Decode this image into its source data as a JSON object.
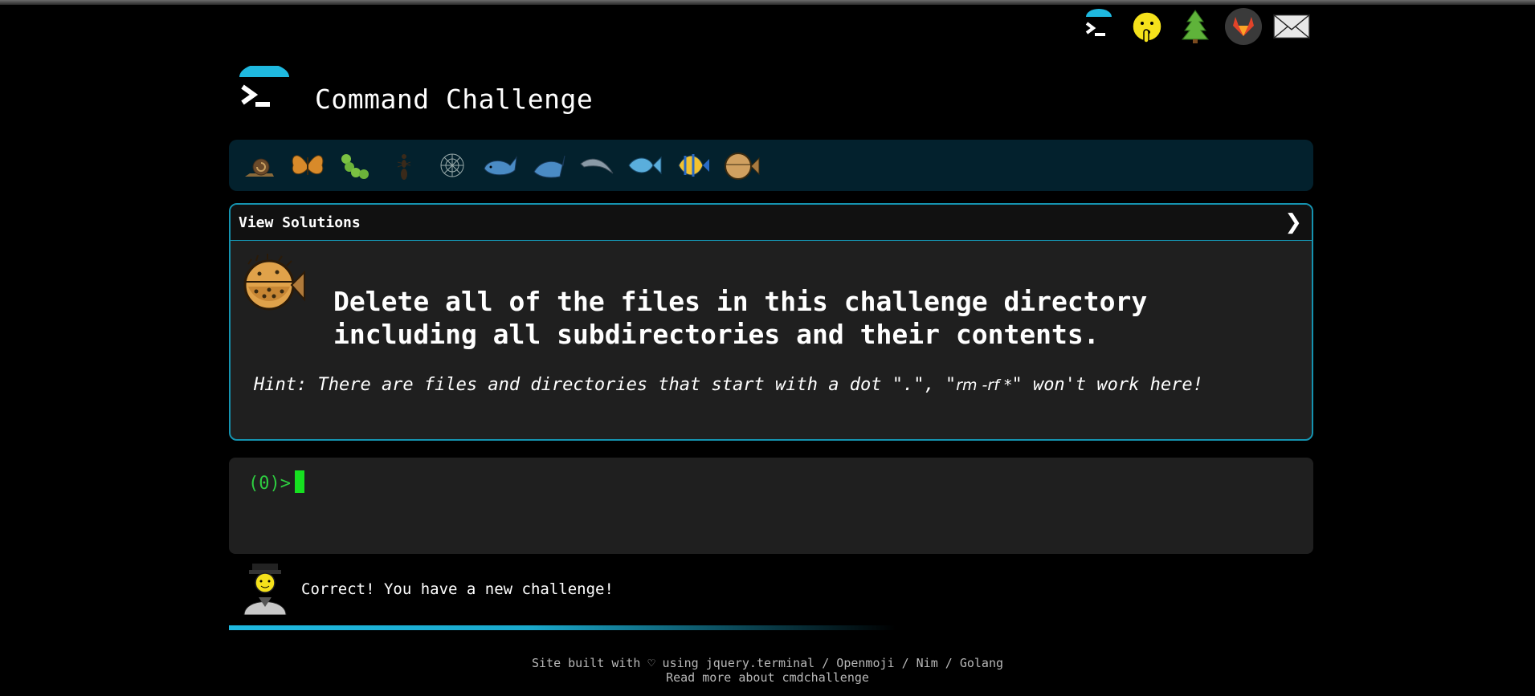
{
  "header": {
    "title": "Command Challenge"
  },
  "top_icons": [
    {
      "icon": "terminal-logo-icon"
    },
    {
      "icon": "shushing-face-icon"
    },
    {
      "icon": "evergreen-tree-icon"
    },
    {
      "icon": "gitlab-icon"
    },
    {
      "icon": "envelope-icon"
    }
  ],
  "levels": [
    {
      "icon": "snail-icon"
    },
    {
      "icon": "butterfly-icon"
    },
    {
      "icon": "caterpillar-icon"
    },
    {
      "icon": "ant-icon"
    },
    {
      "icon": "spider-web-icon"
    },
    {
      "icon": "whale-icon"
    },
    {
      "icon": "shark-icon"
    },
    {
      "icon": "dolphin-icon"
    },
    {
      "icon": "fish-icon"
    },
    {
      "icon": "tropical-fish-icon"
    },
    {
      "icon": "blowfish-icon"
    }
  ],
  "challenge": {
    "view_solutions": "View Solutions",
    "chevron": "❯",
    "task": "Delete all of the files in this challenge directory including all subdirectories and their contents.",
    "hint_prefix": "Hint: There are files and directories that start with a dot \".\", \"",
    "hint_code": "rm -rf *",
    "hint_suffix": "\" won't work here!"
  },
  "terminal": {
    "prompt": "(0)>"
  },
  "status": {
    "message": "Correct! You have a new challenge!",
    "progress": 0.55
  },
  "footer": {
    "line1_prefix": "Site built with ♡ using ",
    "links": [
      "jquery.terminal",
      "Openmoji",
      "Nim",
      "Golang"
    ],
    "sep": " / ",
    "line2": "Read more about cmdchallenge"
  },
  "colors": {
    "accent": "#1593b0",
    "cyan": "#1fb9e0",
    "prompt_green": "#2ecc40",
    "strip_bg": "#03212d"
  }
}
